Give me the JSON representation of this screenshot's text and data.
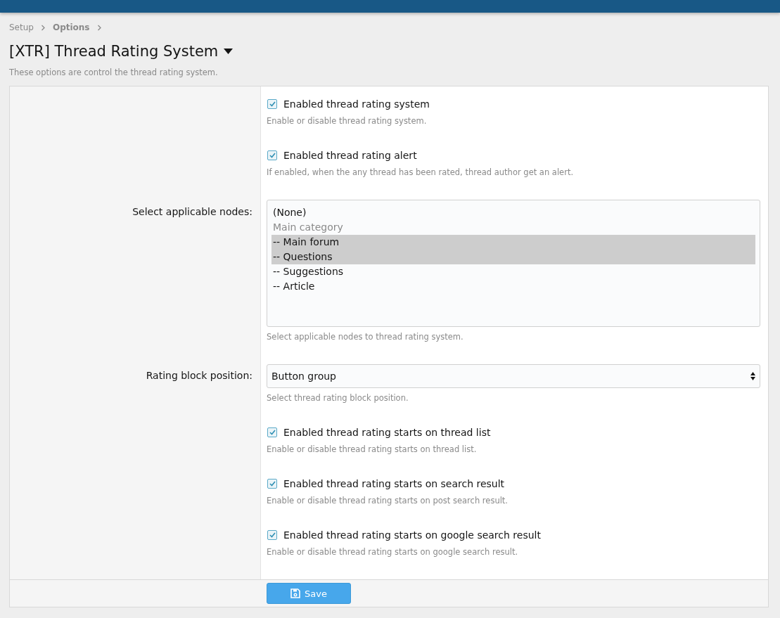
{
  "breadcrumbs": [
    {
      "label": "Setup",
      "current": false
    },
    {
      "label": "Options",
      "current": true
    }
  ],
  "title": "[XTR] Thread Rating System",
  "description": "These options are control the thread rating system.",
  "options": [
    {
      "kind": "checkbox",
      "text": "Enabled thread rating system",
      "checked": true,
      "hint": "Enable or disable thread rating system."
    },
    {
      "kind": "checkbox",
      "text": "Enabled thread rating alert",
      "checked": true,
      "hint": "If enabled, when the any thread has been rated, thread author get an alert."
    },
    {
      "kind": "listbox",
      "label": "Select applicable nodes:",
      "items": [
        {
          "text": "(None)",
          "selected": false,
          "disabled": false
        },
        {
          "text": "Main category",
          "selected": false,
          "disabled": true
        },
        {
          "text": "-- Main forum",
          "selected": true,
          "disabled": false
        },
        {
          "text": "-- Questions",
          "selected": true,
          "disabled": false
        },
        {
          "text": "-- Suggestions",
          "selected": false,
          "disabled": false
        },
        {
          "text": "-- Article",
          "selected": false,
          "disabled": false
        }
      ],
      "hint": "Select applicable nodes to thread rating system."
    },
    {
      "kind": "select",
      "label": "Rating block position:",
      "value": "Button group",
      "hint": "Select thread rating block position."
    },
    {
      "kind": "checkbox",
      "text": "Enabled thread rating starts on thread list",
      "checked": true,
      "hint": "Enable or disable thread rating starts on thread list."
    },
    {
      "kind": "checkbox",
      "text": "Enabled thread rating starts on search result",
      "checked": true,
      "hint": "Enable or disable thread rating starts on post search result."
    },
    {
      "kind": "checkbox",
      "text": "Enabled thread rating starts on google search result",
      "checked": true,
      "hint": "Enable or disable thread rating starts on google search result."
    }
  ],
  "save_button": "Save"
}
